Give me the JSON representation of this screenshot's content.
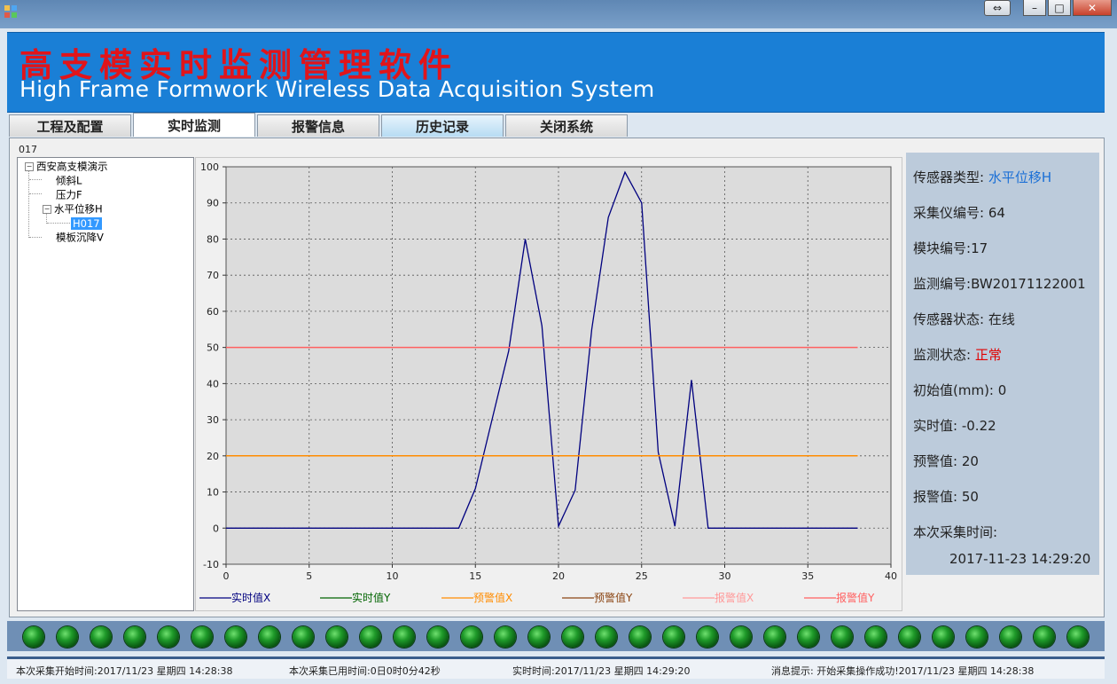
{
  "banner": {
    "title_cn": "高支模实时监测管理软件",
    "title_en": "High Frame Formwork Wireless Data Acquisition System"
  },
  "tabs": [
    {
      "label": "工程及配置"
    },
    {
      "label": "实时监测"
    },
    {
      "label": "报警信息"
    },
    {
      "label": "历史记录"
    },
    {
      "label": "关闭系统"
    }
  ],
  "panel_label": "017",
  "tree": {
    "root": "西安高支模演示",
    "items": [
      "倾斜L",
      "压力F",
      "水平位移H",
      "H017",
      "模板沉降V"
    ]
  },
  "info": {
    "sensor_type_label": "传感器类型:",
    "sensor_type": "水平位移H",
    "collector_label": "采集仪编号:",
    "collector": "64",
    "module_label": "模块编号:",
    "module": "17",
    "monitor_id_label": "监测编号:",
    "monitor_id": "BW20171122001",
    "sensor_state_label": "传感器状态:",
    "sensor_state": "在线",
    "monitor_state_label": "监测状态:",
    "monitor_state": "正常",
    "initial_label": "初始值(mm):",
    "initial": "0",
    "realtime_label": "实时值:",
    "realtime": "-0.22",
    "warning_label": "预警值:",
    "warning": "20",
    "alarm_label": "报警值:",
    "alarm": "50",
    "collect_time_label": "本次采集时间:",
    "collect_time": "2017-11-23 14:29:20"
  },
  "status": {
    "start": "本次采集开始时间:2017/11/23 星期四 14:28:38",
    "elapsed": "本次采集已用时间:0日0时0分42秒",
    "now": "实时时间:2017/11/23 星期四 14:29:20",
    "message": "消息提示: 开始采集操作成功!2017/11/23 星期四 14:28:38"
  },
  "colors": {
    "realtime_x": "#00007f",
    "realtime_y": "#006400",
    "warning_x": "#ff8c00",
    "warning_y": "#8b4513",
    "alarm_x": "#ff9999",
    "alarm_y": "#ff0000"
  },
  "chart_data": {
    "type": "line",
    "xlim": [
      0,
      40
    ],
    "ylim": [
      -10,
      100
    ],
    "x_ticks": [
      0,
      5,
      10,
      15,
      20,
      25,
      30,
      35,
      40
    ],
    "y_ticks": [
      -10,
      0,
      10,
      20,
      30,
      40,
      50,
      60,
      70,
      80,
      90,
      100
    ],
    "grid": true,
    "legend_position": "bottom",
    "series": [
      {
        "name": "实时值X",
        "color": "#00007f",
        "x": [
          0,
          1,
          2,
          3,
          4,
          5,
          6,
          7,
          8,
          9,
          10,
          11,
          12,
          13,
          14,
          15,
          16,
          17,
          18,
          19,
          20,
          21,
          22,
          23,
          24,
          25,
          26,
          27,
          28,
          29,
          30,
          31,
          32,
          33,
          34,
          35,
          36,
          37,
          38
        ],
        "y": [
          0,
          0,
          0,
          0,
          0,
          0,
          0,
          0,
          0,
          0,
          0,
          0,
          0,
          0,
          0,
          11,
          30,
          49,
          80,
          56,
          0.5,
          10.5,
          55,
          86,
          98.5,
          90,
          21,
          0.5,
          41,
          0,
          0,
          0,
          0,
          0,
          0,
          0,
          0,
          0,
          0
        ]
      },
      {
        "name": "实时值Y",
        "color": "#006400",
        "x": [],
        "y": []
      },
      {
        "name": "预警值X",
        "color": "#ff8c00",
        "x": [
          0,
          38
        ],
        "y": [
          20,
          20
        ]
      },
      {
        "name": "预警值Y",
        "color": "#8b4513",
        "x": [],
        "y": []
      },
      {
        "name": "报警值X",
        "color": "#ff9999",
        "x": [],
        "y": []
      },
      {
        "name": "报警值Y",
        "color": "#ff6060",
        "x": [
          0,
          38
        ],
        "y": [
          50,
          50
        ]
      }
    ]
  }
}
